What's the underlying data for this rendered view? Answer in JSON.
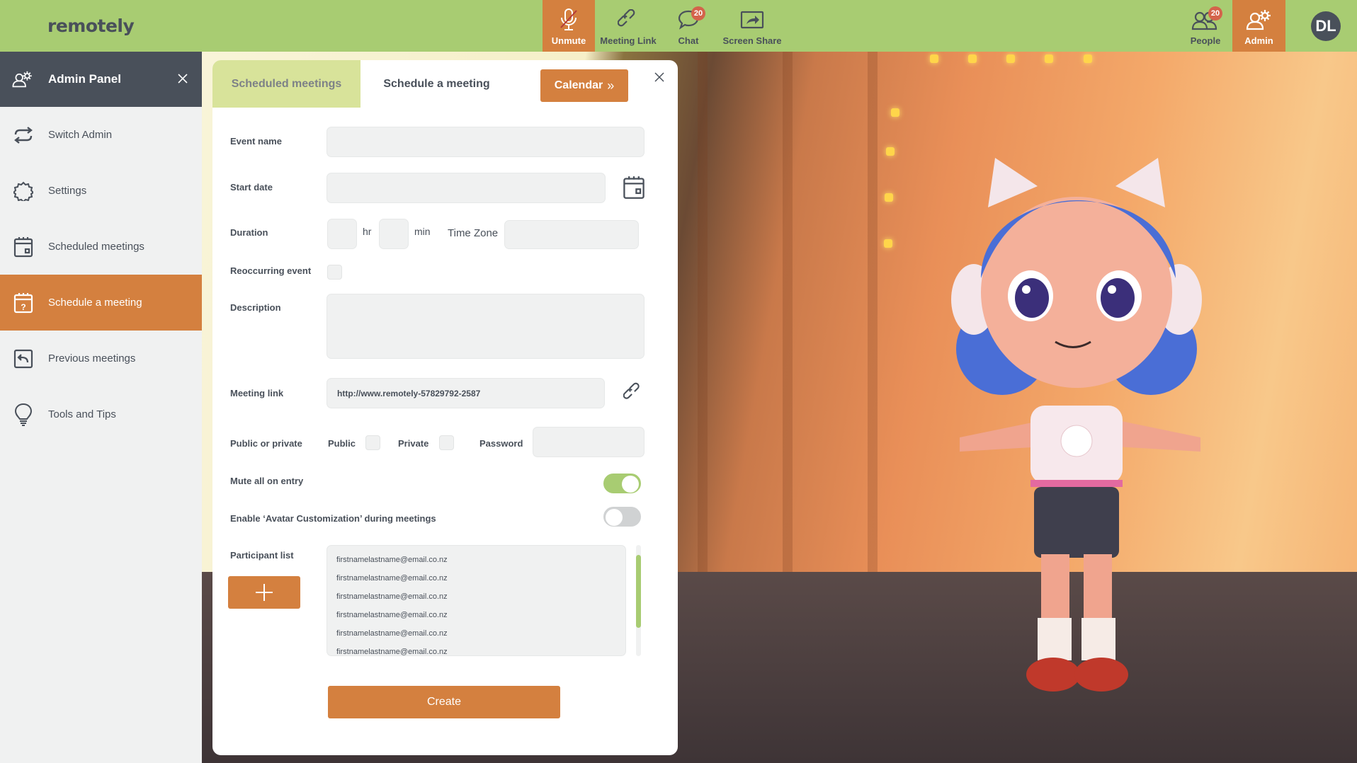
{
  "app": {
    "logo": "remotely"
  },
  "topbar": {
    "nav": [
      {
        "label": "Unmute",
        "icon": "mic-muted-icon",
        "active": true
      },
      {
        "label": "Meeting Link",
        "icon": "link-icon"
      },
      {
        "label": "Chat",
        "icon": "chat-bubble-icon",
        "badge": "20"
      },
      {
        "label": "Screen Share",
        "icon": "screen-share-icon"
      },
      {
        "label": "People",
        "icon": "people-icon",
        "badge": "20"
      },
      {
        "label": "Admin",
        "icon": "admin-gear-icon",
        "active": true
      }
    ],
    "user_initials": "DL"
  },
  "sidebar": {
    "title": "Admin Panel",
    "items": [
      {
        "label": "Switch Admin",
        "icon": "switch-arrows-icon"
      },
      {
        "label": "Settings",
        "icon": "gear-icon"
      },
      {
        "label": "Scheduled meetings",
        "icon": "calendar-icon"
      },
      {
        "label": "Schedule a meeting",
        "icon": "calendar-question-icon",
        "active": true
      },
      {
        "label": "Previous meetings",
        "icon": "return-arrow-icon"
      },
      {
        "label": "Tools and Tips",
        "icon": "lightbulb-icon"
      }
    ]
  },
  "modal": {
    "tabs": [
      {
        "label": "Scheduled meetings"
      },
      {
        "label": "Schedule a meeting",
        "active": true
      }
    ],
    "calendar_button": "Calendar",
    "calendar_chevron": "»",
    "fields": {
      "event_name": {
        "label": "Event name",
        "value": ""
      },
      "start_date": {
        "label": "Start date",
        "value": ""
      },
      "duration": {
        "label": "Duration",
        "hr_value": "",
        "hr_unit": "hr",
        "min_value": "",
        "min_unit": "min"
      },
      "time_zone": {
        "label": "Time Zone",
        "value": ""
      },
      "reoccurring": {
        "label": "Reoccurring event",
        "checked": false
      },
      "description": {
        "label": "Description",
        "value": ""
      },
      "meeting_link": {
        "label": "Meeting link",
        "value": "http://www.remotely-57829792-2587"
      },
      "visibility": {
        "label": "Public or private",
        "public_label": "Public",
        "public_checked": false,
        "private_label": "Private",
        "private_checked": false,
        "password_label": "Password",
        "password_value": ""
      },
      "mute_all": {
        "label": "Mute all on entry",
        "on": true
      },
      "avatar_customization": {
        "label": "Enable ‘Avatar Customization’ during meetings",
        "on": false
      }
    },
    "participants": {
      "label": "Participant list",
      "emails": [
        "firstnamelastname@email.co.nz",
        "firstnamelastname@email.co.nz",
        "firstnamelastname@email.co.nz",
        "firstnamelastname@email.co.nz",
        "firstnamelastname@email.co.nz",
        "firstnamelastname@email.co.nz"
      ]
    },
    "create_button": "Create"
  },
  "colors": {
    "topbar": "#a8cc72",
    "accent": "#d4803f",
    "dark": "#49505a",
    "tab_inactive": "#d8e39a",
    "badge": "#d4634b",
    "field_bg": "#f0f1f1"
  }
}
